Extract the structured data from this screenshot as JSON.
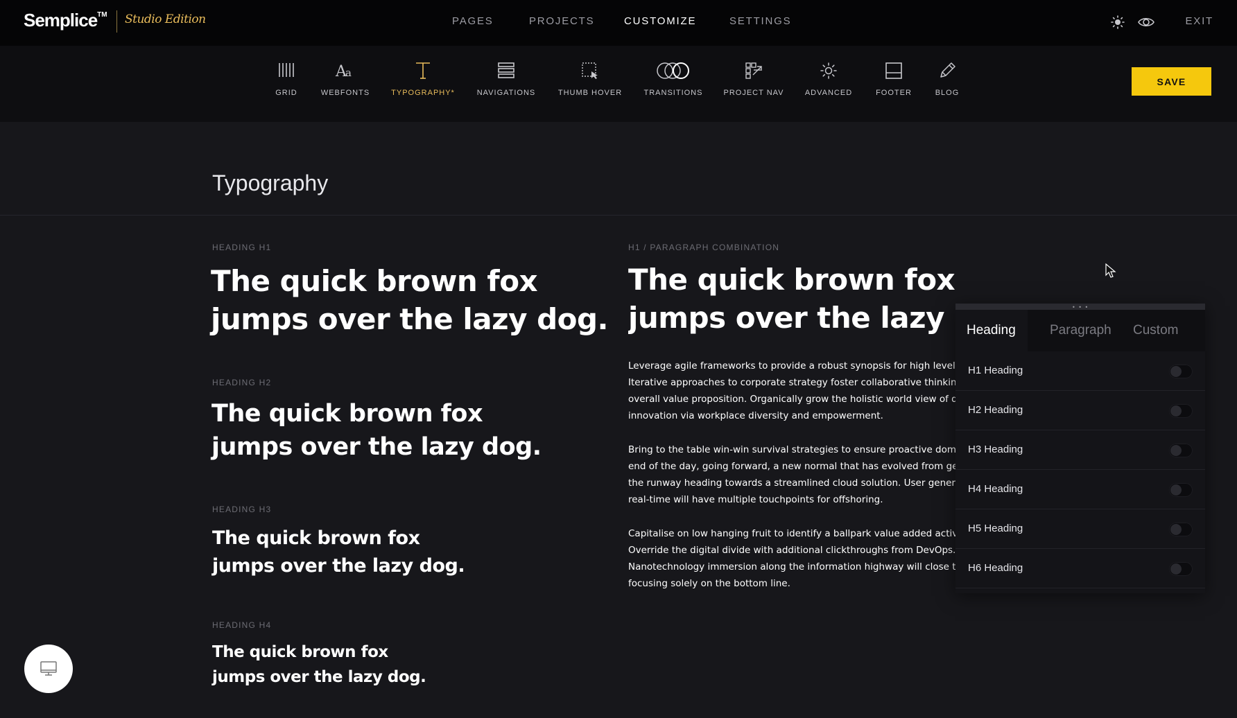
{
  "brand": {
    "name": "Semplice",
    "tm": "TM",
    "edition": "Studio Edition"
  },
  "main_nav": [
    {
      "label": "PAGES"
    },
    {
      "label": "PROJECTS"
    },
    {
      "label": "CUSTOMIZE",
      "active": true
    },
    {
      "label": "SETTINGS"
    }
  ],
  "top_right": {
    "icons": [
      "sun-icon",
      "eye-icon"
    ],
    "exit_label": "EXIT"
  },
  "toolbar": {
    "items": [
      {
        "label": "GRID",
        "icon": "grid-icon"
      },
      {
        "label": "WEBFONTS",
        "icon": "webfonts-icon"
      },
      {
        "label": "TYPOGRAPHY*",
        "icon": "typography-icon",
        "active": true
      },
      {
        "label": "NAVIGATIONS",
        "icon": "navigations-icon"
      },
      {
        "label": "THUMB HOVER",
        "icon": "thumb-hover-icon"
      },
      {
        "label": "TRANSITIONS",
        "icon": "transitions-icon"
      },
      {
        "label": "PROJECT NAV",
        "icon": "project-nav-icon"
      },
      {
        "label": "ADVANCED",
        "icon": "advanced-icon"
      },
      {
        "label": "FOOTER",
        "icon": "footer-icon"
      },
      {
        "label": "BLOG",
        "icon": "blog-icon"
      }
    ],
    "save_label": "SAVE"
  },
  "page": {
    "title": "Typography",
    "samples": [
      {
        "label": "HEADING H1",
        "line1": "The quick brown fox",
        "line2": "jumps over the lazy dog."
      },
      {
        "label": "HEADING H2",
        "line1": "The quick brown fox",
        "line2": "jumps over the lazy dog."
      },
      {
        "label": "HEADING H3",
        "line1": "The quick brown fox",
        "line2": "jumps over the lazy dog."
      },
      {
        "label": "HEADING H4",
        "line1": "The quick brown fox",
        "line2": "jumps over the lazy dog."
      }
    ],
    "combination": {
      "label": "H1 / PARAGRAPH COMBINATION",
      "heading_line1": "The quick brown fox",
      "heading_line2": "jumps over the lazy do",
      "paragraphs": [
        [
          "Leverage agile frameworks to provide a robust synopsis for high level ov",
          "Iterative approaches to corporate strategy foster collaborative thinking",
          "overall value proposition. Organically grow the holistic world view of dis",
          "innovation via workplace diversity and empowerment."
        ],
        [
          "Bring to the table win-win survival strategies to ensure proactive domi",
          "end of the day, going forward, a new normal that has evolved from gene",
          "the runway heading towards a streamlined cloud solution. User generat",
          "real-time will have multiple touchpoints for offshoring."
        ],
        [
          "Capitalise on low hanging fruit to identify a ballpark value added activi",
          "Override the digital divide with additional clickthroughs from DevOps.",
          "Nanotechnology immersion along the information highway will close th",
          "focusing solely on the bottom line."
        ]
      ]
    }
  },
  "panel": {
    "handle_grip": "• • •",
    "tabs": [
      {
        "label": "Heading",
        "active": true
      },
      {
        "label": "Paragraph"
      },
      {
        "label": "Custom"
      }
    ],
    "rows": [
      {
        "label": "H1 Heading",
        "on": false
      },
      {
        "label": "H2 Heading",
        "on": false
      },
      {
        "label": "H3 Heading",
        "on": false
      },
      {
        "label": "H4 Heading",
        "on": false
      },
      {
        "label": "H5 Heading",
        "on": false
      },
      {
        "label": "H6 Heading",
        "on": false
      }
    ]
  },
  "colors": {
    "accent": "#e9bc5b",
    "save": "#f5c80d",
    "background": "#17171b"
  }
}
